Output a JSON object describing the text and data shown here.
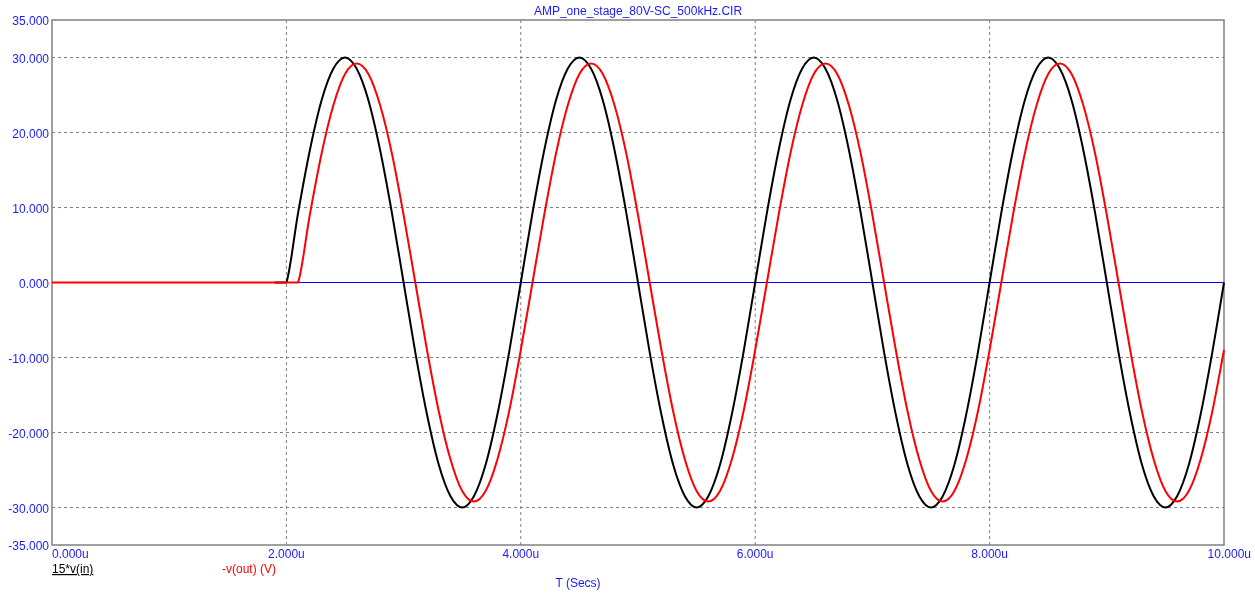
{
  "plot": {
    "chart_data": {
      "type": "line",
      "title": "AMP_one_stage_80V-SC_500kHz.CIR",
      "xlabel": "T (Secs)",
      "xlim": [
        0,
        10
      ],
      "ylim": [
        -35,
        35
      ],
      "grid": true,
      "ref_lines": [
        {
          "axis": "y",
          "value": 0,
          "color": "#0000ff"
        }
      ],
      "xticks": [
        {
          "value": 0,
          "label": "0.000u"
        },
        {
          "value": 2,
          "label": "2.000u"
        },
        {
          "value": 4,
          "label": "4.000u"
        },
        {
          "value": 6,
          "label": "6.000u"
        },
        {
          "value": 8,
          "label": "8.000u"
        },
        {
          "value": 10,
          "label": "10.000u"
        }
      ],
      "yticks": [
        {
          "value": 35,
          "label": "35.000"
        },
        {
          "value": 30,
          "label": "30.000"
        },
        {
          "value": 20,
          "label": "20.000"
        },
        {
          "value": 10,
          "label": "10.000"
        },
        {
          "value": 0,
          "label": "0.000"
        },
        {
          "value": -10,
          "label": "-10.000"
        },
        {
          "value": -20,
          "label": "-20.000"
        },
        {
          "value": -30,
          "label": "-30.000"
        },
        {
          "value": -35,
          "label": "-35.000"
        }
      ],
      "x": [
        0,
        0.1,
        0.2,
        0.3,
        0.4,
        0.5,
        0.6,
        0.7,
        0.8,
        0.9,
        1,
        1.1,
        1.2,
        1.3,
        1.4,
        1.5,
        1.6,
        1.7,
        1.8,
        1.9,
        2,
        2.1,
        2.2,
        2.3,
        2.4,
        2.5,
        2.6,
        2.7,
        2.8,
        2.9,
        3,
        3.1,
        3.2,
        3.3,
        3.4,
        3.5,
        3.6,
        3.7,
        3.8,
        3.9,
        4,
        4.1,
        4.2,
        4.3,
        4.4,
        4.5,
        4.6,
        4.7,
        4.8,
        4.9,
        5,
        5.1,
        5.2,
        5.3,
        5.4,
        5.5,
        5.6,
        5.7,
        5.8,
        5.9,
        6,
        6.1,
        6.2,
        6.3,
        6.4,
        6.5,
        6.6,
        6.7,
        6.8,
        6.9,
        7,
        7.1,
        7.2,
        7.3,
        7.4,
        7.5,
        7.6,
        7.7,
        7.8,
        7.9,
        8,
        8.1,
        8.2,
        8.3,
        8.4,
        8.5,
        8.6,
        8.7,
        8.8,
        8.9,
        9,
        9.1,
        9.2,
        9.3,
        9.4,
        9.5,
        9.6,
        9.7,
        9.8,
        9.9,
        10
      ],
      "series": [
        {
          "name": "15*v(in)",
          "color": "#000000",
          "values": [
            null,
            null,
            null,
            null,
            null,
            null,
            null,
            null,
            null,
            null,
            null,
            null,
            null,
            null,
            null,
            null,
            null,
            null,
            null,
            0,
            0,
            9.3,
            17.6,
            24.3,
            28.5,
            30,
            28.5,
            24.3,
            17.6,
            9.3,
            0,
            -9.3,
            -17.6,
            -24.3,
            -28.5,
            -30,
            -28.5,
            -24.3,
            -17.6,
            -9.3,
            0,
            9.3,
            17.6,
            24.3,
            28.5,
            30,
            28.5,
            24.3,
            17.6,
            9.3,
            0,
            -9.3,
            -17.6,
            -24.3,
            -28.5,
            -30,
            -28.5,
            -24.3,
            -17.6,
            -9.3,
            0,
            9.3,
            17.6,
            24.3,
            28.5,
            30,
            28.5,
            24.3,
            17.6,
            9.3,
            0,
            -9.3,
            -17.6,
            -24.3,
            -28.5,
            -30,
            -28.5,
            -24.3,
            -17.6,
            -9.3,
            0,
            9.3,
            17.6,
            24.3,
            28.5,
            30,
            28.5,
            24.3,
            17.6,
            9.3,
            0,
            -9.3,
            -17.6,
            -24.3,
            -28.5,
            -30,
            -28.5,
            -24.3,
            -17.6,
            -9.3,
            0
          ]
        },
        {
          "name": "-v(out) (V)",
          "color": "#ff0000",
          "values": [
            0,
            0,
            0,
            0,
            0,
            0,
            0,
            0,
            0,
            0,
            0,
            0,
            0,
            0,
            0,
            0,
            0,
            0,
            0,
            0,
            0,
            0,
            9,
            17.2,
            23.6,
            27.8,
            29.2,
            27.8,
            23.6,
            17.2,
            9,
            0,
            -9,
            -17.2,
            -23.6,
            -27.8,
            -29.2,
            -27.8,
            -23.6,
            -17.2,
            -9,
            0,
            9,
            17.2,
            23.6,
            27.8,
            29.2,
            27.8,
            23.6,
            17.2,
            9,
            0,
            -9,
            -17.2,
            -23.6,
            -27.8,
            -29.2,
            -27.8,
            -23.6,
            -17.2,
            -9,
            0,
            9,
            17.2,
            23.6,
            27.8,
            29.2,
            27.8,
            23.6,
            17.2,
            9,
            0,
            -9,
            -17.2,
            -23.6,
            -27.8,
            -29.2,
            -27.8,
            -23.6,
            -17.2,
            -9,
            0,
            9,
            17.2,
            23.6,
            27.8,
            29.2,
            27.8,
            23.6,
            17.2,
            9,
            0,
            -9,
            -17.2,
            -23.6,
            -27.8,
            -29.2,
            -27.8,
            -23.6,
            -17.2,
            -9
          ]
        }
      ]
    },
    "legend": [
      {
        "selected": true
      },
      {
        "selected": false
      }
    ]
  }
}
